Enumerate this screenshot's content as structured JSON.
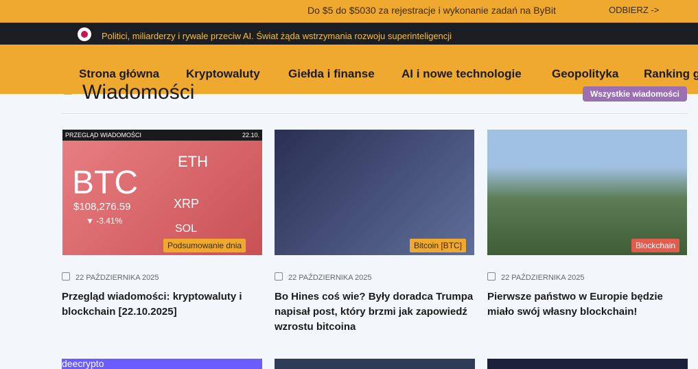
{
  "promo": {
    "text": "Do $5 do $5030 za rejestracje i wykonanie zadań na ByBit",
    "button": "ODBIERZ ->"
  },
  "ticker": {
    "text": "Politici, miliarderzy i rywale przeciw AI. Świat żąda wstrzymania rozwoju superinteligencji"
  },
  "nav": {
    "items": [
      "Strona główna",
      "Kryptowaluty",
      "Giełda i finanse",
      "AI i nowe technologie",
      "Geopolityka",
      "Ranking g"
    ]
  },
  "section": {
    "title": "Wiadomości",
    "all_button": "Wszystkie wiadomości"
  },
  "cards": [
    {
      "image_header": "PRZEGLĄD WIADOMOŚCI",
      "image_date": "22.10.",
      "image_btc": "BTC",
      "image_btc_price": "$108,276.59",
      "image_btc_change": "▼ -3.41%",
      "image_eth": "ETH",
      "image_xrp": "XRP",
      "image_sol": "SOL",
      "tag": "Podsumowanie dnia",
      "date": "22 PAŹDZIERNIKA 2025",
      "title": "Przegląd wiadomości: kryptowaluty i blockchain [22.10.2025]"
    },
    {
      "tag": "Bitcoin [BTC]",
      "date": "22 PAŹDZIERNIKA 2025",
      "title": "Bo Hines coś wie? Były doradca Trumpa napisał post, który brzmi jak zapowiedź wzrostu bitcoina"
    },
    {
      "tag": "Blockchain",
      "date": "22 PAŹDZIERNIKA 2025",
      "title": "Pierwsze państwo w Europie będzie miało swój własny blockchain!"
    }
  ],
  "bottom_cards": [
    {
      "image_text": "deecrypto"
    },
    {
      "image_text": ""
    },
    {
      "image_text": ""
    }
  ],
  "colors": {
    "brand": "#f0a92f",
    "dark": "#1d1d24",
    "accent_purple": "#9c6fb3",
    "tag_red": "#e25b4f"
  },
  "icons": {
    "logo": "logo-icon",
    "section": "section-icon",
    "date": "calendar-icon"
  }
}
